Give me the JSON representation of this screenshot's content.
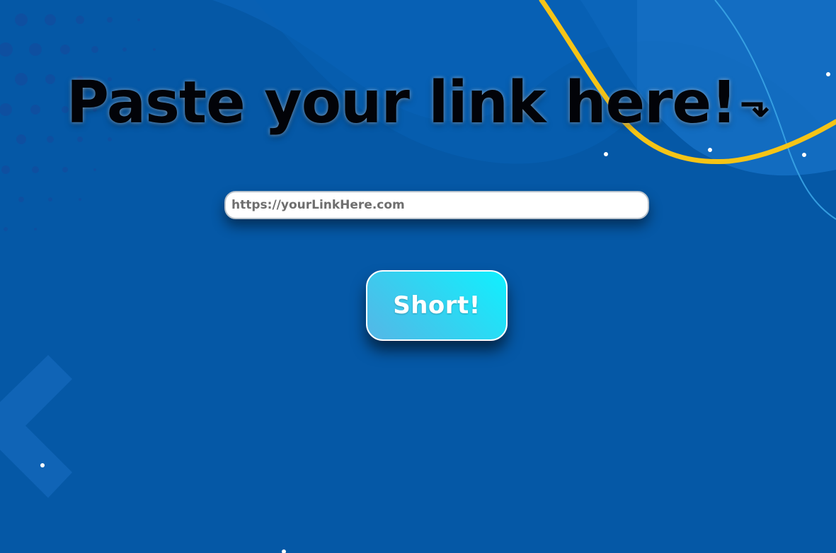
{
  "hero": {
    "title": "Paste your link here!",
    "title_arrow_icon": "arrow-turn-down-icon"
  },
  "form": {
    "url_placeholder": "https://yourLinkHere.com",
    "url_value": "",
    "submit_label": "Short!"
  },
  "colors": {
    "background": "#0558a6",
    "accent_curve": "#f6c416",
    "button_gradient_start": "#10f0ff",
    "button_gradient_end": "#55b6e6",
    "headline": "#020308"
  }
}
